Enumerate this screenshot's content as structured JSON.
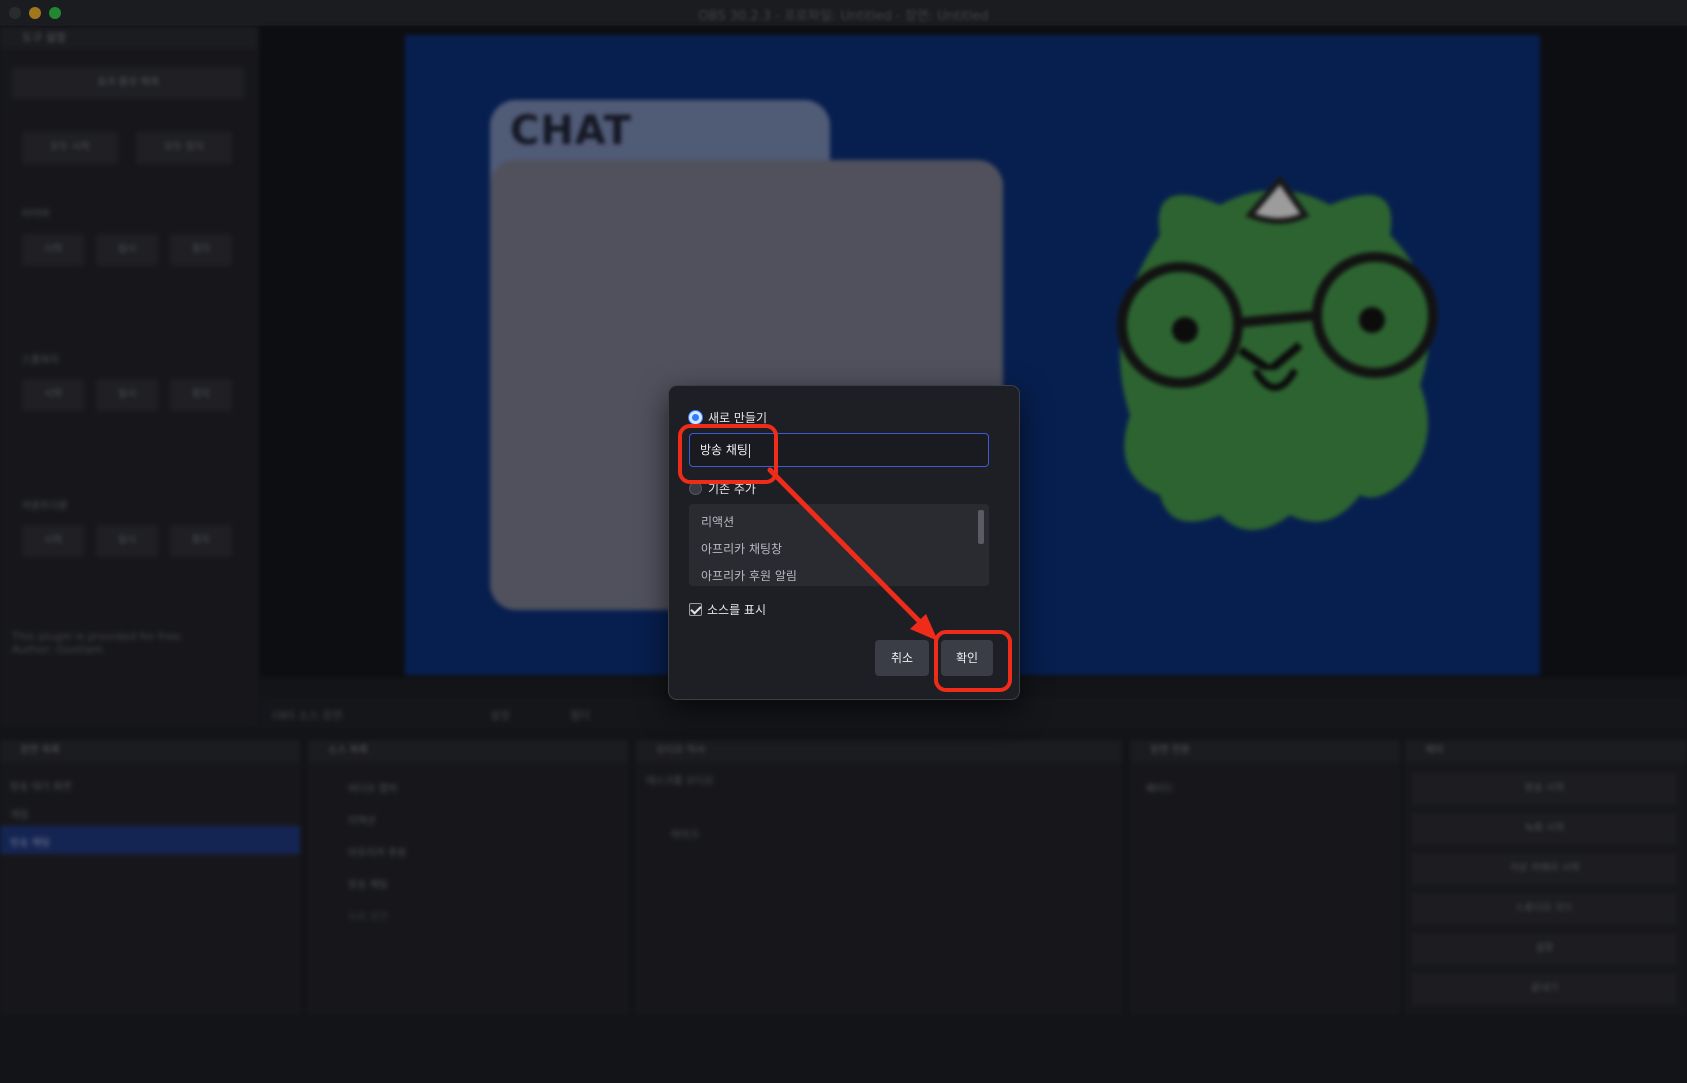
{
  "window": {
    "title": "OBS 30.2.3 - 프로파일: Untitled - 장면: Untitled"
  },
  "left_dock": {
    "header": "도구 설정",
    "buttons": [
      "효과 활성 해제",
      "모두 시작",
      "모두 정지"
    ],
    "sections": [
      {
        "label": "타이머",
        "buttons": [
          "시작",
          "일시",
          "정지"
        ]
      },
      {
        "label": "스톱워치",
        "buttons": [
          "시작",
          "일시",
          "정지"
        ]
      },
      {
        "label": "카운트다운",
        "buttons": [
          "시작",
          "일시",
          "정지"
        ]
      }
    ],
    "footer_text": "This plugin is provided for free. Author: Gootlam"
  },
  "preview": {
    "chat_title": "CHAT"
  },
  "below_preview": {
    "label": "OBS 소스 장면",
    "buttons": [
      "설정",
      "필터"
    ]
  },
  "panels": {
    "scenes": {
      "title": "장면 목록",
      "items": [
        "방송 대기 화면",
        "게임",
        "방송 채팅"
      ]
    },
    "sources": {
      "title": "소스 목록",
      "items": [
        "비디오 캡처",
        "리액션",
        "아프리카 후원",
        "방송 채팅",
        "녹화 화면"
      ]
    },
    "mixer": {
      "title": "오디오 믹서",
      "items": [
        "데스크톱 오디오",
        "마이크"
      ]
    },
    "transition": {
      "title": "장면 전환",
      "value": "페이드"
    },
    "controls": {
      "title": "제어",
      "buttons": [
        "방송 시작",
        "녹화 시작",
        "가상 카메라 시작",
        "스튜디오 모드",
        "설정",
        "끝내기"
      ]
    }
  },
  "dialog": {
    "radio_new_label": "새로 만들기",
    "name_input_value": "방송 채팅",
    "radio_existing_label": "기존 추가",
    "existing_items": [
      "리액션",
      "아프리카 채팅창",
      "아프리카 후원 알림"
    ],
    "visible_checkbox_label": "소스를 표시",
    "visible_checked": true,
    "cancel_label": "취소",
    "ok_label": "확인"
  },
  "annotation": {
    "color": "#ee2c19"
  }
}
